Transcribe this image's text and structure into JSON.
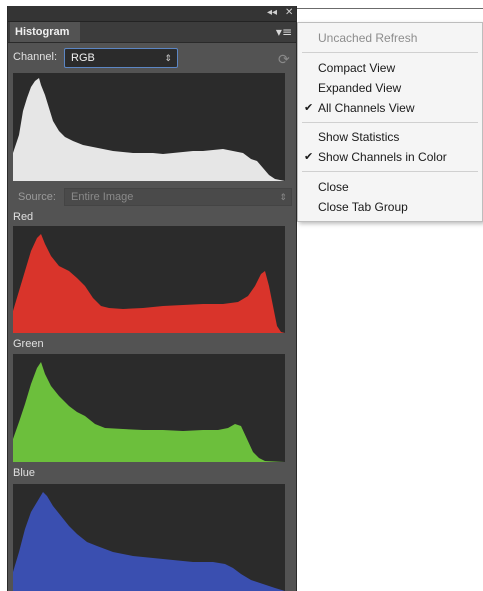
{
  "panel": {
    "collapse_icon": "double-left-arrow-icon",
    "close_icon": "close-icon",
    "tab_label": "Histogram",
    "menu_icon": "panel-menu-icon",
    "channel_label": "Channel:",
    "channel_value": "RGB",
    "refresh_icon": "refresh-icon",
    "source_label": "Source:",
    "source_value": "Entire Image",
    "channels": [
      {
        "label": "Red",
        "color": "#d9342b"
      },
      {
        "label": "Green",
        "color": "#6cbf3c"
      },
      {
        "label": "Blue",
        "color": "#3a4fb0"
      }
    ],
    "composite_color": "#e6e6e6"
  },
  "menu": {
    "items": [
      {
        "label": "Uncached Refresh",
        "checked": false,
        "disabled": true
      },
      {
        "label": "Compact View",
        "checked": false,
        "disabled": false
      },
      {
        "label": "Expanded View",
        "checked": false,
        "disabled": false
      },
      {
        "label": "All Channels View",
        "checked": true,
        "disabled": false
      },
      {
        "label": "Show Statistics",
        "checked": false,
        "disabled": false
      },
      {
        "label": "Show Channels in Color",
        "checked": true,
        "disabled": false
      },
      {
        "label": "Close",
        "checked": false,
        "disabled": false
      },
      {
        "label": "Close Tab Group",
        "checked": false,
        "disabled": false
      }
    ],
    "check_glyph": "✔"
  }
}
